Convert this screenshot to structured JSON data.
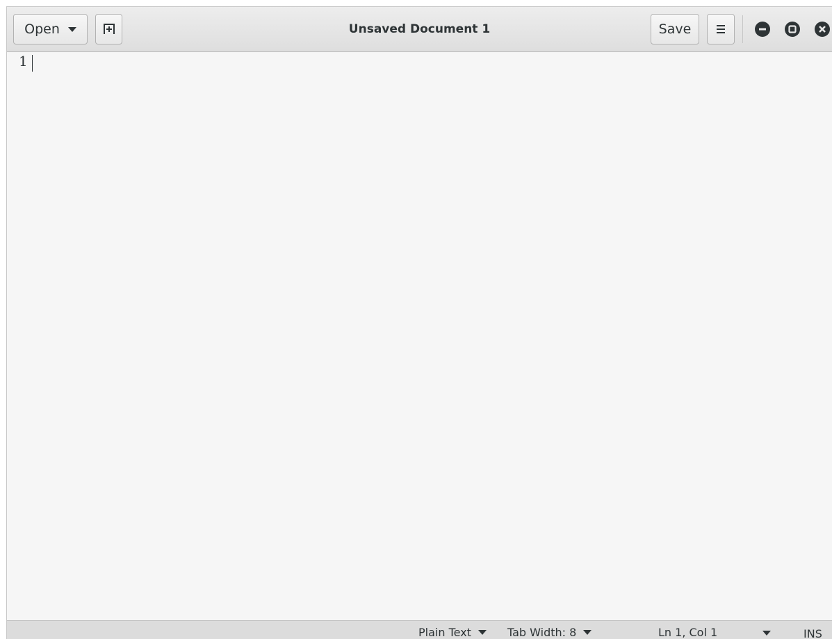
{
  "header": {
    "open_label": "Open",
    "title": "Unsaved Document 1",
    "save_label": "Save"
  },
  "editor": {
    "line_numbers": [
      "1"
    ]
  },
  "status": {
    "language": "Plain Text",
    "tab_width": "Tab Width: 8",
    "cursor_position": "Ln 1, Col 1",
    "mode": "INS"
  },
  "icons": {
    "new_tab": "new-tab-icon",
    "menu": "hamburger-menu-icon",
    "minimize": "minimize-icon",
    "maximize": "maximize-icon",
    "close": "close-icon"
  },
  "colors": {
    "background": "#f6f6f6",
    "headerbar": "#e3e3e3",
    "statusbar": "#dcdcdc",
    "text": "#2e3436"
  }
}
